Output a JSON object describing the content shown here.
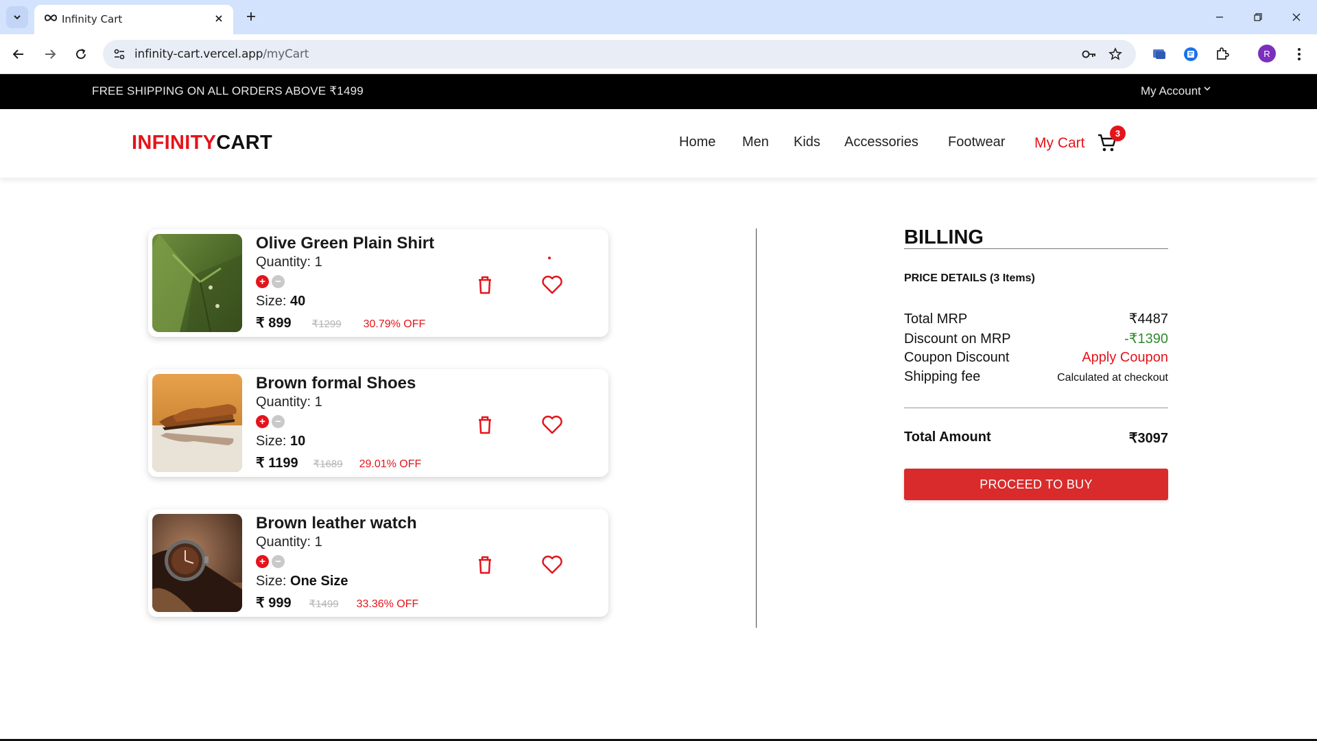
{
  "browser": {
    "tab_title": "Infinity Cart",
    "url_host": "infinity-cart.vercel.app",
    "url_path": "/myCart",
    "profile_initial": "R"
  },
  "promo": {
    "text": "FREE SHIPPING ON ALL ORDERS ABOVE ₹1499",
    "account_label": "My Account"
  },
  "header": {
    "logo_red": "INFINITY",
    "logo_black": "CART",
    "nav": [
      "Home",
      "Men",
      "Kids",
      "Accessories",
      "Footwear"
    ],
    "cart_label": "My Cart",
    "cart_count": "3"
  },
  "cart": {
    "items": [
      {
        "name": "Olive Green Plain Shirt",
        "quantity_label": "Quantity: 1",
        "size_label": "Size: ",
        "size": "40",
        "price": "₹ 899",
        "mrp": "₹1299",
        "discount": "30.79% OFF",
        "image": "shirt"
      },
      {
        "name": "Brown formal Shoes",
        "quantity_label": "Quantity: 1",
        "size_label": "Size: ",
        "size": "10",
        "price": "₹ 1199",
        "mrp": "₹1689",
        "discount": "29.01% OFF",
        "image": "shoes"
      },
      {
        "name": "Brown leather watch",
        "quantity_label": "Quantity: 1",
        "size_label": "Size: ",
        "size": "One Size",
        "price": "₹ 999",
        "mrp": "₹1499",
        "discount": "33.36% OFF",
        "image": "watch"
      }
    ],
    "plus_glyph": "+",
    "minus_glyph": "−"
  },
  "billing": {
    "title": "BILLING",
    "price_details": "PRICE DETAILS (3 Items)",
    "rows": [
      {
        "label": "Total MRP",
        "value": "₹4487"
      },
      {
        "label": "Discount on MRP",
        "value": "-₹1390"
      },
      {
        "label": "Coupon Discount",
        "value": "Apply Coupon"
      },
      {
        "label": "Shipping fee",
        "value": "Calculated at checkout"
      }
    ],
    "total_label": "Total Amount",
    "total_value": "₹3097",
    "buy_label": "PROCEED TO BUY"
  },
  "colors": {
    "brand_red": "#e4141b",
    "discount_green": "#2e8b2e",
    "buy_button": "#d92b2b",
    "promo_bg": "#000000"
  },
  "icons": [
    "chevron-down-icon",
    "infinity-icon",
    "close-icon",
    "plus-icon",
    "minimize-icon",
    "restore-icon",
    "back-arrow-icon",
    "forward-arrow-icon",
    "reload-icon",
    "site-settings-icon",
    "key-icon",
    "star-icon",
    "extension-icon",
    "puzzle-icon",
    "more-vert-icon",
    "cart-icon",
    "trash-icon",
    "heart-icon"
  ]
}
